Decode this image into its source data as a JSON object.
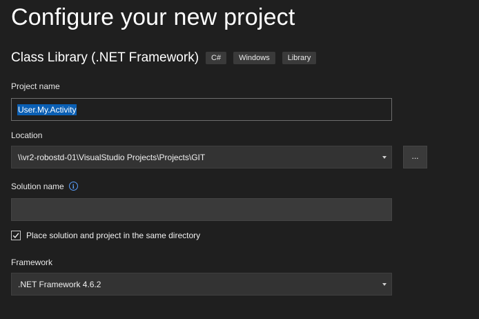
{
  "header": {
    "title": "Configure your new project"
  },
  "template": {
    "name": "Class Library (.NET Framework)",
    "tags": [
      "C#",
      "Windows",
      "Library"
    ]
  },
  "project_name": {
    "label": "Project name",
    "value": "User.My.Activity"
  },
  "location": {
    "label": "Location",
    "value": "\\\\vr2-robostd-01\\VisualStudio Projects\\Projects\\GIT",
    "browse_label": "..."
  },
  "solution_name": {
    "label": "Solution name",
    "info_icon": "info-icon",
    "placeholder": "",
    "value": ""
  },
  "same_directory": {
    "label": "Place solution and project in the same directory",
    "checked": true
  },
  "framework": {
    "label": "Framework",
    "value": ".NET Framework 4.6.2"
  },
  "colors": {
    "background": "#1f1f1f",
    "selection": "#0a5fb4",
    "info_accent": "#5aa0ff"
  }
}
